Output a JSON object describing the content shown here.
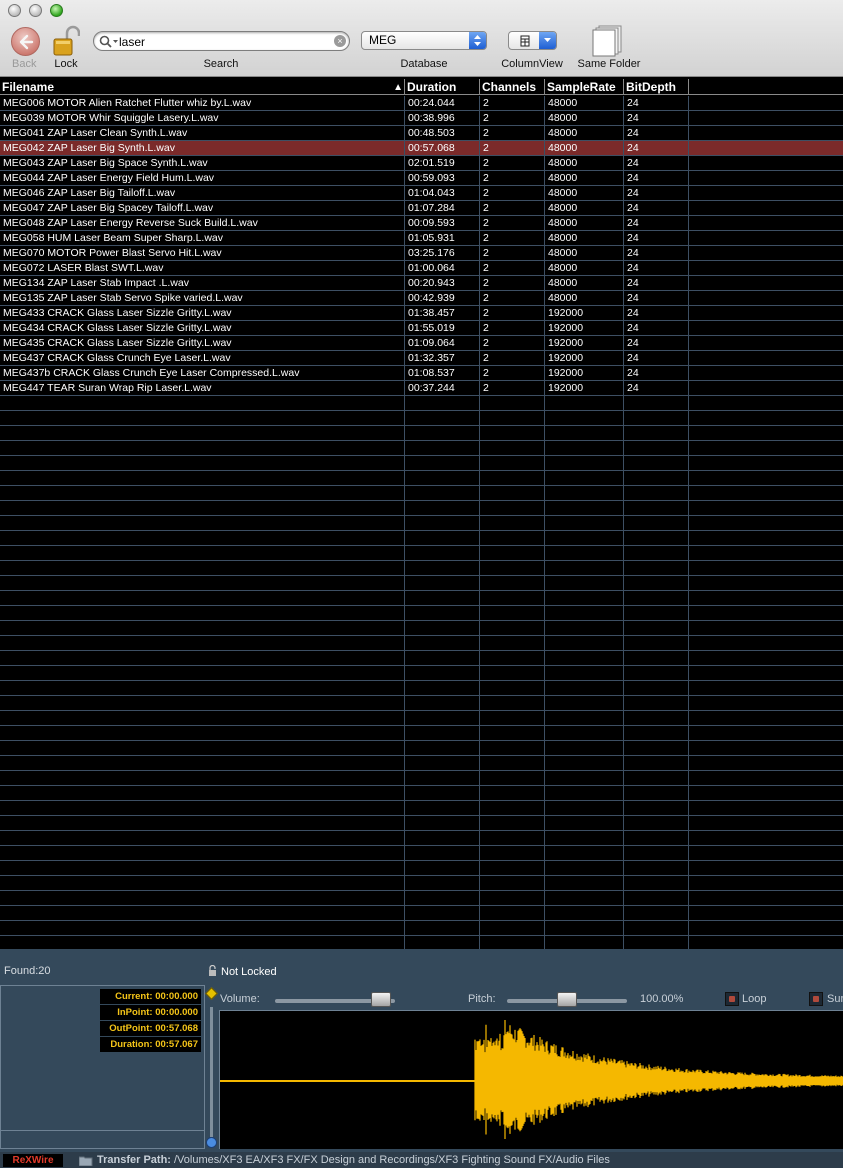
{
  "toolbar": {
    "back_label": "Back",
    "lock_label": "Lock",
    "search_label": "Search",
    "search_value": "laser",
    "database_label": "Database",
    "database_value": "MEG",
    "columnview_label": "ColumnView",
    "samefolder_label": "Same Folder",
    "icons": [
      "back-arrow-icon",
      "padlock-open-icon",
      "magnifier-icon",
      "clear-icon",
      "column-view-icon",
      "same-folder-icon"
    ]
  },
  "table": {
    "columns": [
      "Filename",
      "Duration",
      "Channels",
      "SampleRate",
      "BitDepth"
    ],
    "sort_column": "Filename",
    "sort_direction": "ascending",
    "selected_index": 3,
    "rows": [
      [
        "MEG006 MOTOR Alien Ratchet Flutter whiz by.L.wav",
        "00:24.044",
        "2",
        "48000",
        "24"
      ],
      [
        "MEG039 MOTOR Whir Squiggle Lasery.L.wav",
        "00:38.996",
        "2",
        "48000",
        "24"
      ],
      [
        "MEG041 ZAP Laser Clean Synth.L.wav",
        "00:48.503",
        "2",
        "48000",
        "24"
      ],
      [
        "MEG042 ZAP Laser Big Synth.L.wav",
        "00:57.068",
        "2",
        "48000",
        "24"
      ],
      [
        "MEG043 ZAP Laser Big Space Synth.L.wav",
        "02:01.519",
        "2",
        "48000",
        "24"
      ],
      [
        "MEG044 ZAP Laser Energy Field Hum.L.wav",
        "00:59.093",
        "2",
        "48000",
        "24"
      ],
      [
        "MEG046 ZAP Laser Big Tailoff.L.wav",
        "01:04.043",
        "2",
        "48000",
        "24"
      ],
      [
        "MEG047 ZAP Laser Big Spacey Tailoff.L.wav",
        "01:07.284",
        "2",
        "48000",
        "24"
      ],
      [
        "MEG048 ZAP Laser Energy Reverse Suck Build.L.wav",
        "00:09.593",
        "2",
        "48000",
        "24"
      ],
      [
        "MEG058 HUM Laser Beam Super Sharp.L.wav",
        "01:05.931",
        "2",
        "48000",
        "24"
      ],
      [
        "MEG070 MOTOR Power Blast Servo Hit.L.wav",
        "03:25.176",
        "2",
        "48000",
        "24"
      ],
      [
        "MEG072 LASER Blast SWT.L.wav",
        "01:00.064",
        "2",
        "48000",
        "24"
      ],
      [
        "MEG134 ZAP Laser Stab Impact .L.wav",
        "00:20.943",
        "2",
        "48000",
        "24"
      ],
      [
        "MEG135 ZAP Laser Stab Servo Spike varied.L.wav",
        "00:42.939",
        "2",
        "48000",
        "24"
      ],
      [
        "MEG433 CRACK Glass Laser Sizzle Gritty.L.wav",
        "01:38.457",
        "2",
        "192000",
        "24"
      ],
      [
        "MEG434 CRACK Glass Laser Sizzle Gritty.L.wav",
        "01:55.019",
        "2",
        "192000",
        "24"
      ],
      [
        "MEG435 CRACK Glass Laser Sizzle Gritty.L.wav",
        "01:09.064",
        "2",
        "192000",
        "24"
      ],
      [
        "MEG437 CRACK Glass Crunch Eye Laser.L.wav",
        "01:32.357",
        "2",
        "192000",
        "24"
      ],
      [
        "MEG437b CRACK Glass Crunch Eye Laser Compressed.L.wav",
        "01:08.537",
        "2",
        "192000",
        "24"
      ],
      [
        "MEG447 TEAR Suran Wrap Rip Laser.L.wav",
        "00:37.244",
        "2",
        "192000",
        "24"
      ]
    ]
  },
  "bottom": {
    "found": "Found:20",
    "lock_state": "Not Locked",
    "current": "Current: 00:00.000",
    "inpoint": "InPoint: 00:00.000",
    "outpoint": "OutPoint: 00:57.068",
    "duration": "Duration: 00:57.067",
    "volume_label": "Volume:",
    "volume_level": 0.88,
    "pitch_label": "Pitch:",
    "pitch_value": "100.00%",
    "pitch_level": 0.5,
    "loop_label": "Loop",
    "sur_label": "Sur",
    "waveform_color": "#f5b800"
  },
  "status": {
    "logo": "ReXWire",
    "transfer_label": "Transfer Path:",
    "transfer_path": "/Volumes/XF3 EA/XF3 FX/FX Design and Recordings/XF3 Fighting Sound FX/Audio Files"
  }
}
